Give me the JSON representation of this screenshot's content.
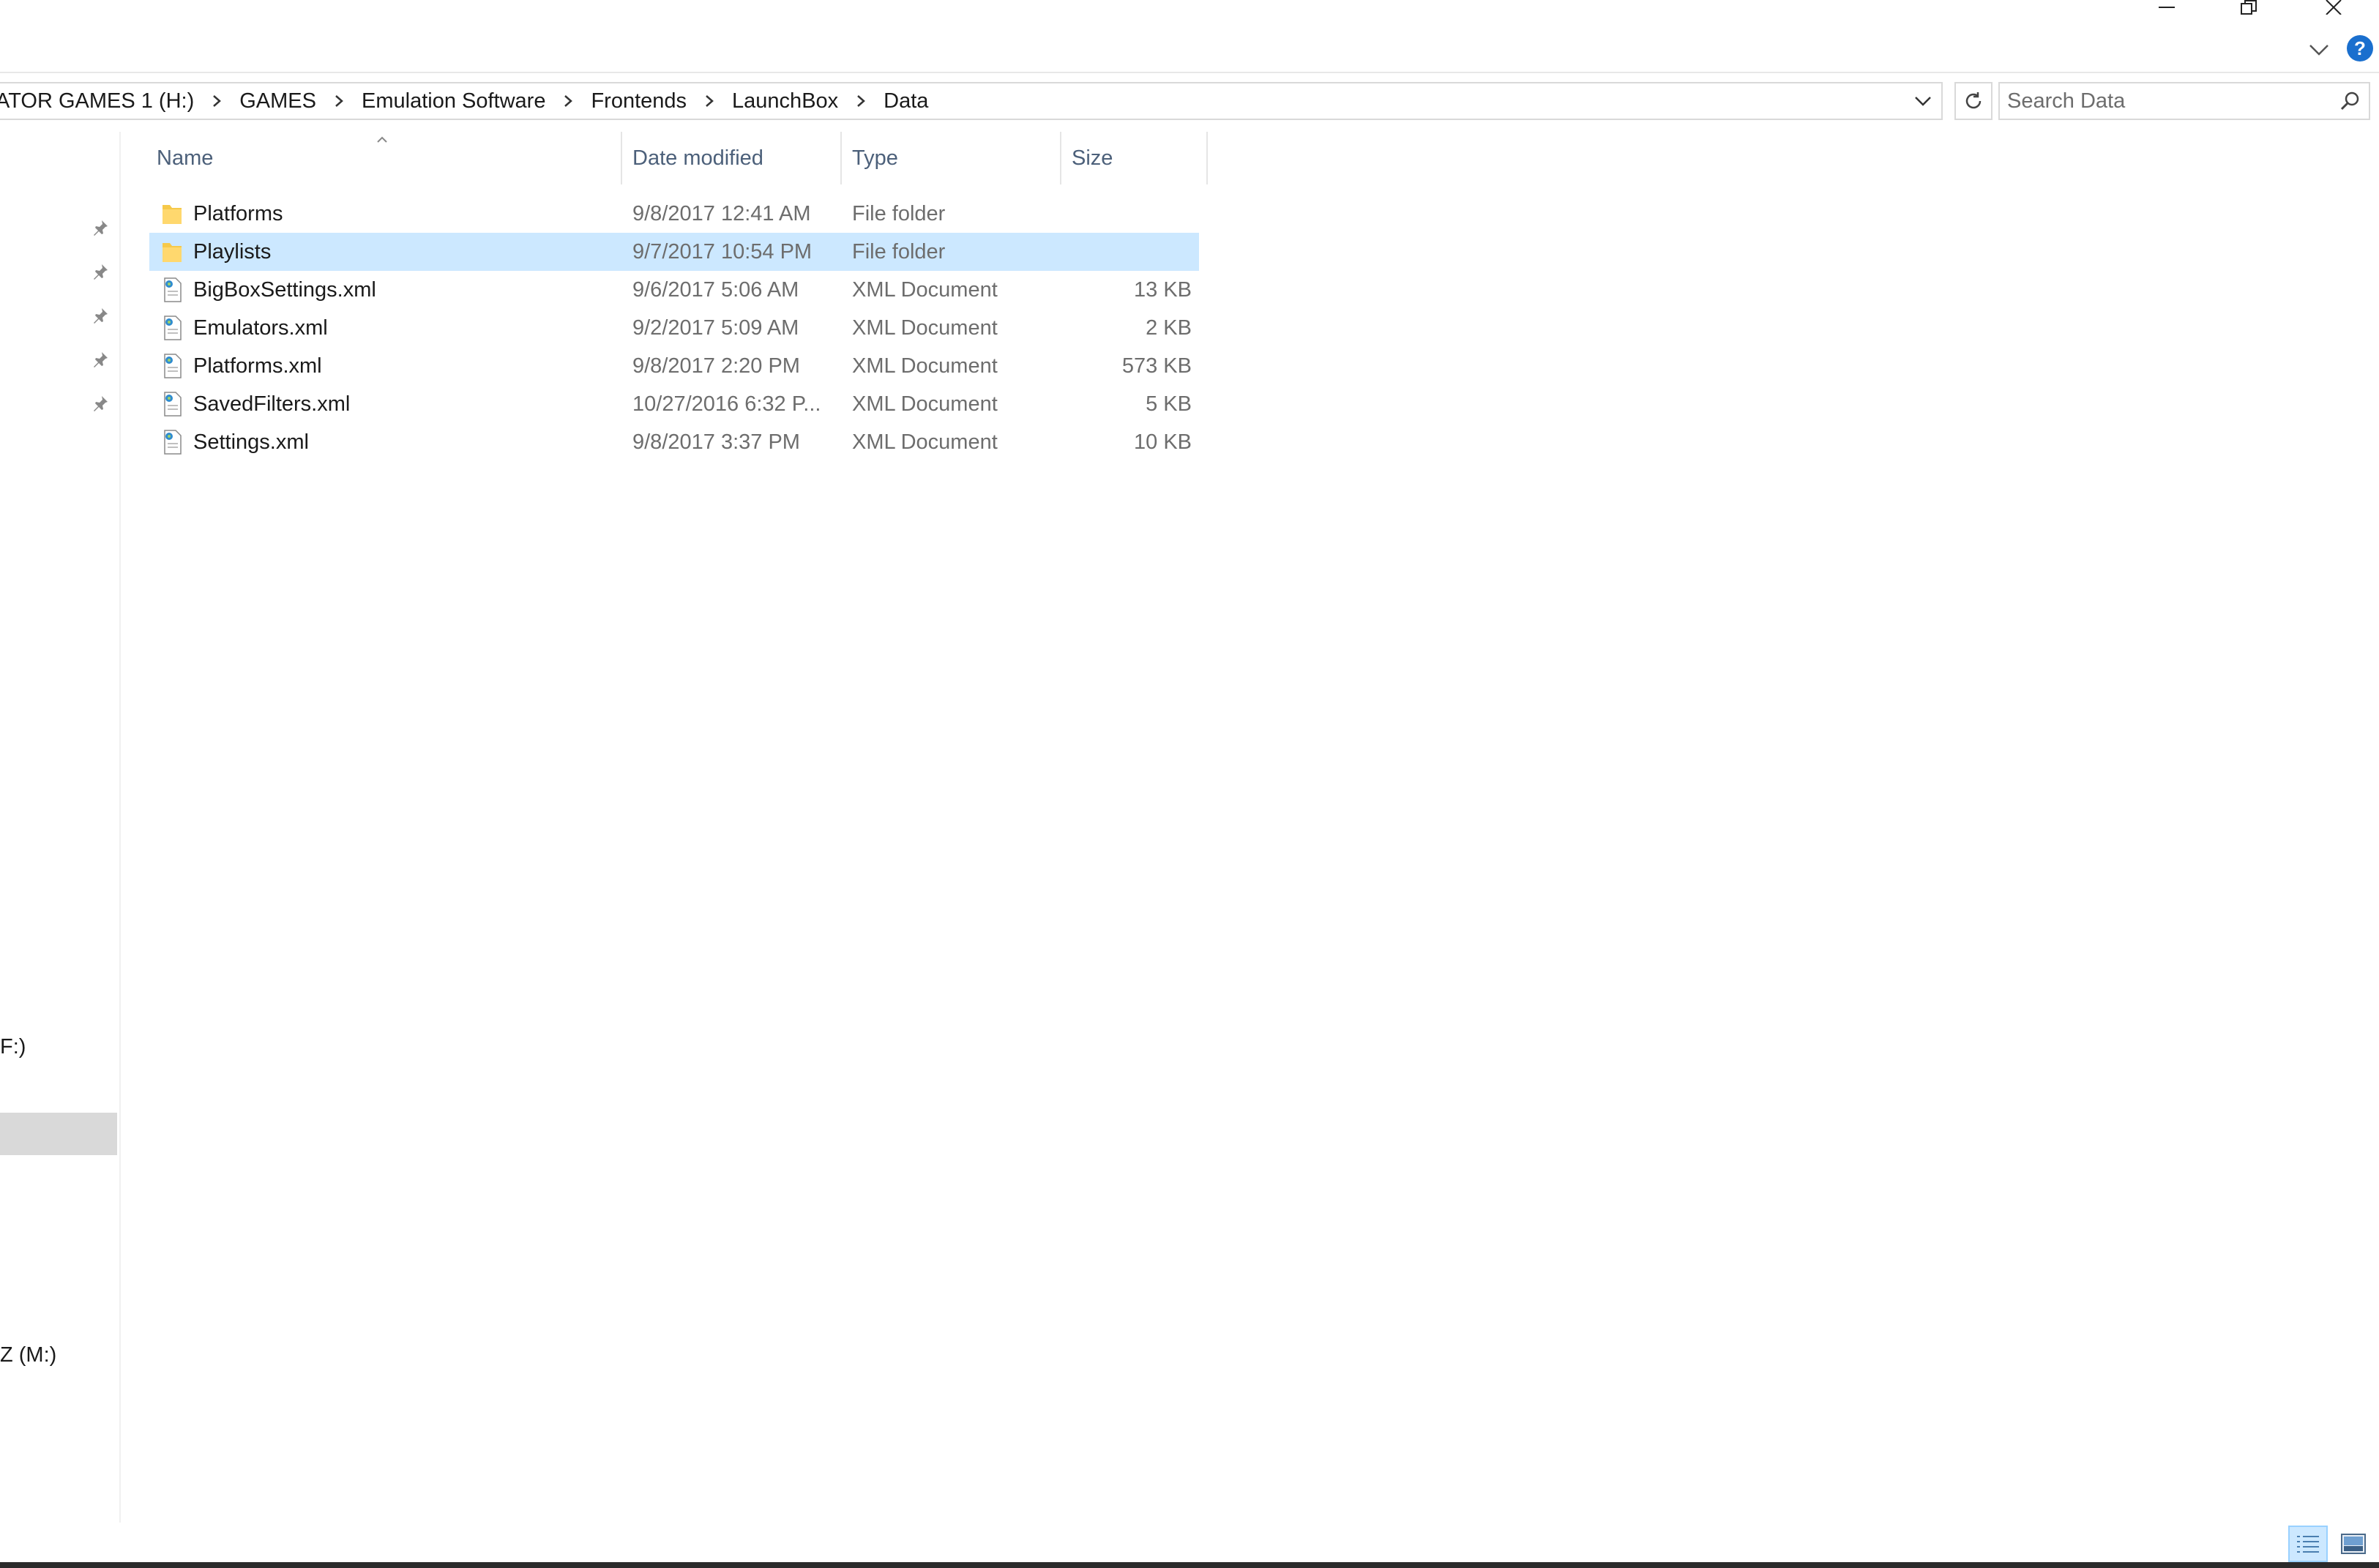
{
  "window": {
    "controls": {
      "minimize_icon": "minimize-icon",
      "restore_icon": "restore-icon",
      "close_icon": "close-icon"
    },
    "help_label": "?"
  },
  "address": {
    "crumbs": [
      "ATOR GAMES 1 (H:)",
      "GAMES",
      "Emulation Software",
      "Frontends",
      "LaunchBox",
      "Data"
    ]
  },
  "search": {
    "placeholder": "Search Data",
    "value": ""
  },
  "nav": {
    "partial_items": [
      "F:)",
      "Z (M:)"
    ]
  },
  "columns": {
    "name": "Name",
    "date": "Date modified",
    "type": "Type",
    "size": "Size"
  },
  "files": [
    {
      "name": "Platforms",
      "date": "9/8/2017 12:41 AM",
      "type": "File folder",
      "size": "",
      "kind": "folder"
    },
    {
      "name": "Playlists",
      "date": "9/7/2017 10:54 PM",
      "type": "File folder",
      "size": "",
      "kind": "folder",
      "selected": true
    },
    {
      "name": "BigBoxSettings.xml",
      "date": "9/6/2017 5:06 AM",
      "type": "XML Document",
      "size": "13 KB",
      "kind": "xml"
    },
    {
      "name": "Emulators.xml",
      "date": "9/2/2017 5:09 AM",
      "type": "XML Document",
      "size": "2 KB",
      "kind": "xml"
    },
    {
      "name": "Platforms.xml",
      "date": "9/8/2017 2:20 PM",
      "type": "XML Document",
      "size": "573 KB",
      "kind": "xml"
    },
    {
      "name": "SavedFilters.xml",
      "date": "10/27/2016 6:32 P...",
      "type": "XML Document",
      "size": "5 KB",
      "kind": "xml"
    },
    {
      "name": "Settings.xml",
      "date": "9/8/2017 3:37 PM",
      "type": "XML Document",
      "size": "10 KB",
      "kind": "xml"
    }
  ],
  "colors": {
    "selection": "#cce8ff",
    "header_text": "#4c607a",
    "help_blue": "#1a6fce",
    "folder": "#f6c94a"
  }
}
